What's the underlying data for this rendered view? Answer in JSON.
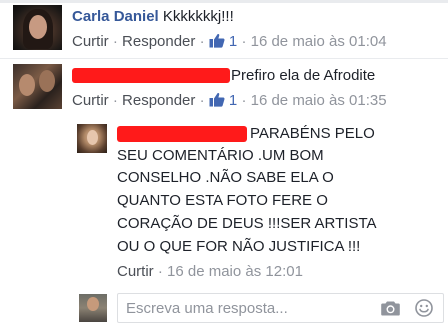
{
  "comments": [
    {
      "author": "Carla Daniel",
      "text": "Kkkkkkkj!!!",
      "actions": {
        "like": "Curtir",
        "reply": "Responder",
        "likes": "1",
        "time": "16 de maio às 01:04"
      }
    },
    {
      "author": "",
      "text": "Prefiro ela de Afrodite",
      "actions": {
        "like": "Curtir",
        "reply": "Responder",
        "likes": "1",
        "time": "16 de maio às 01:35"
      }
    }
  ],
  "reply": {
    "lines": [
      "PARABÉNS PELO",
      "SEU COMENTÁRIO .UM BOM",
      "CONSELHO .NÃO SABE ELA O",
      "QUANTO ESTA FOTO FERE O",
      "CORAÇÃO DE DEUS !!!SER ARTISTA",
      "OU O QUE FOR NÃO JUSTIFICA !!!"
    ],
    "actions": {
      "like": "Curtir",
      "time": "16 de maio às 12:01"
    }
  },
  "composer": {
    "placeholder": "Escreva uma resposta...",
    "icons": [
      "camera-icon",
      "smiley-icon"
    ]
  },
  "colors": {
    "author": "#365899",
    "meta": "#90949c",
    "like_accent": "#4267b2",
    "redaction": "#ff1a1a"
  },
  "separators": {
    "dot": "·"
  }
}
